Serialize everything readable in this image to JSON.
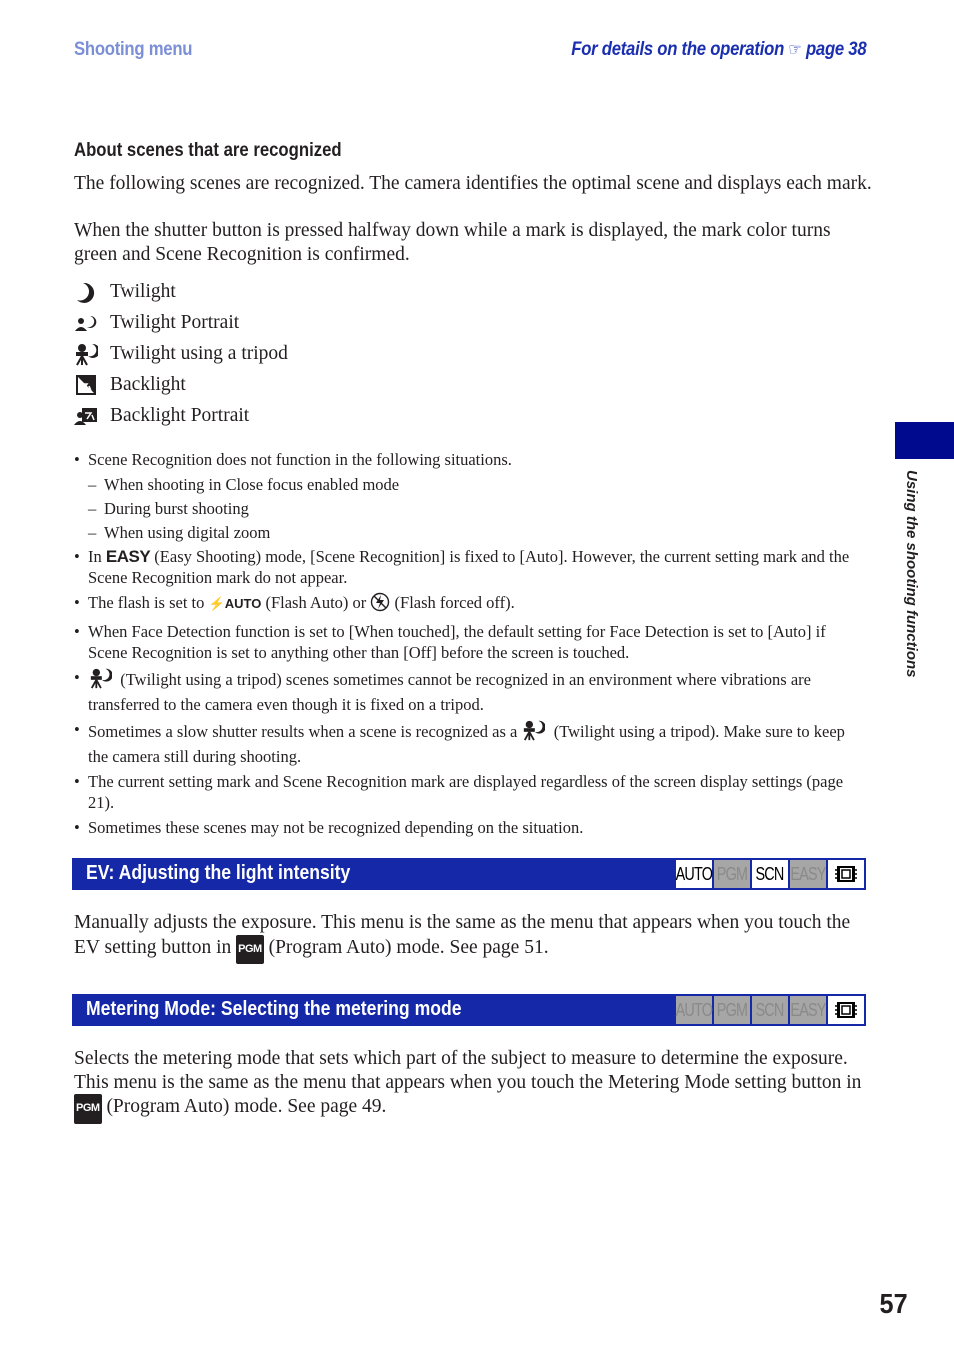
{
  "header": {
    "section": "Shooting menu",
    "details_prefix": "For details on the operation",
    "details_icon": "pointing-hand-icon",
    "details_page": "page 38"
  },
  "about": {
    "title": "About scenes that are recognized",
    "para1": "The following scenes are recognized. The camera identifies the optimal scene and displays each mark.",
    "para2": "When the shutter button is pressed halfway down while a mark is displayed, the mark color turns green and Scene Recognition is confirmed."
  },
  "scenes": [
    {
      "icon": "twilight-icon",
      "label": "Twilight"
    },
    {
      "icon": "twilight-portrait-icon",
      "label": "Twilight Portrait"
    },
    {
      "icon": "twilight-tripod-icon",
      "label": "Twilight using a tripod"
    },
    {
      "icon": "backlight-icon",
      "label": "Backlight"
    },
    {
      "icon": "backlight-portrait-icon",
      "label": "Backlight Portrait"
    }
  ],
  "notes": {
    "n1": "Scene Recognition does not function in the following situations.",
    "n1_subs": [
      "When shooting in Close focus enabled mode",
      "During burst shooting",
      "When using digital zoom"
    ],
    "n2_prefix": "In",
    "n2_glyph": "EASY",
    "n2_rest": "(Easy Shooting) mode, [Scene Recognition] is fixed to [Auto]. However, the current setting mark and the Scene Recognition mark do not appear.",
    "n3_prefix": "The flash is set to",
    "n3_glyph1": "AUTO",
    "n3_mid": "(Flash Auto) or",
    "n3_rest": "(Flash forced off).",
    "n4": "When Face Detection function is set to [When touched], the default setting for Face Detection is set to [Auto] if Scene Recognition is set to anything other than [Off] before the screen is touched.",
    "n5_rest": "(Twilight using a tripod) scenes sometimes cannot be recognized in an environment where vibrations are transferred to the camera even though it is fixed on a tripod.",
    "n6_prefix": "Sometimes a slow shutter results when a scene is recognized as a",
    "n6_rest": "(Twilight using a tripod). Make sure to keep the camera still during shooting.",
    "n7": "The current setting mark and Scene Recognition mark are displayed regardless of the screen display settings (page 21).",
    "n8": "Sometimes these scenes may not be recognized depending on the situation."
  },
  "ev": {
    "title": "EV: Adjusting the light intensity",
    "modes": [
      {
        "label": "AUTO",
        "enabled": true
      },
      {
        "label": "PGM",
        "enabled": false
      },
      {
        "label": "SCN",
        "enabled": true
      },
      {
        "label": "EASY",
        "enabled": false
      },
      {
        "label": "movie",
        "enabled": true
      }
    ],
    "body_a": "Manually adjusts the exposure. This menu is the same as the menu that appears when you touch the EV setting button in",
    "pgm": "PGM",
    "body_b": "(Program Auto) mode. See page 51."
  },
  "metering": {
    "title": "Metering Mode: Selecting the metering mode",
    "modes": [
      {
        "label": "AUTO",
        "enabled": false
      },
      {
        "label": "PGM",
        "enabled": false
      },
      {
        "label": "SCN",
        "enabled": false
      },
      {
        "label": "EASY",
        "enabled": false
      },
      {
        "label": "movie",
        "enabled": true
      }
    ],
    "body_a": "Selects the metering mode that sets which part of the subject to measure to determine the exposure. This menu is the same as the menu that appears when you touch the Metering Mode setting button in",
    "pgm": "PGM",
    "body_b": "(Program Auto) mode. See page 49."
  },
  "side_tab": {
    "label": "Using the shooting functions",
    "color": "#000a8f"
  },
  "page_number": "57",
  "colors": {
    "bar": "#1428a8",
    "header_left": "#7b8fd6",
    "header_right": "#1a2fb0",
    "mode_off": "#a6a6a6"
  }
}
